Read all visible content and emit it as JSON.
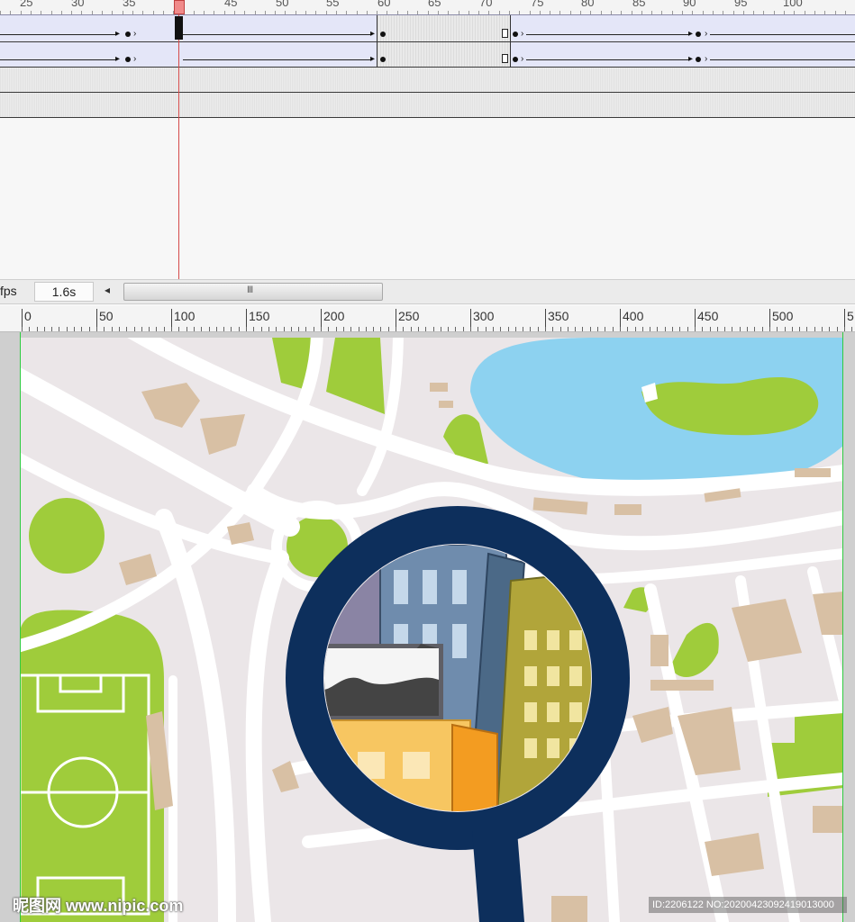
{
  "timeline": {
    "ruler_labels": [
      "25",
      "30",
      "35",
      "",
      "45",
      "50",
      "55",
      "60",
      "65",
      "70",
      "75",
      "80",
      "85",
      "90",
      "95",
      "100"
    ],
    "playhead_frame": 41
  },
  "status": {
    "fps_label": "fps",
    "elapsed_time": "1.6s",
    "scroll_left_arrow": "◂",
    "scroll_grip": "III"
  },
  "stage_ruler": {
    "labels": [
      "0",
      "50",
      "100",
      "150",
      "200",
      "250",
      "300",
      "350",
      "400",
      "450",
      "500",
      "5"
    ]
  },
  "colors": {
    "map_background": "#ebe6e8",
    "road": "#ffffff",
    "park_green": "#9fcc3b",
    "lake_blue": "#8dd2f0",
    "building_tan": "#d8c0a4",
    "magnifier_ring": "#0d2f5c",
    "tween_band": "#e4e6f8",
    "guide_green": "#2ecc40"
  },
  "watermark": {
    "site": "昵图网 www.nipic.com",
    "id": "ID:2206122 NO:20200423092419013000"
  }
}
